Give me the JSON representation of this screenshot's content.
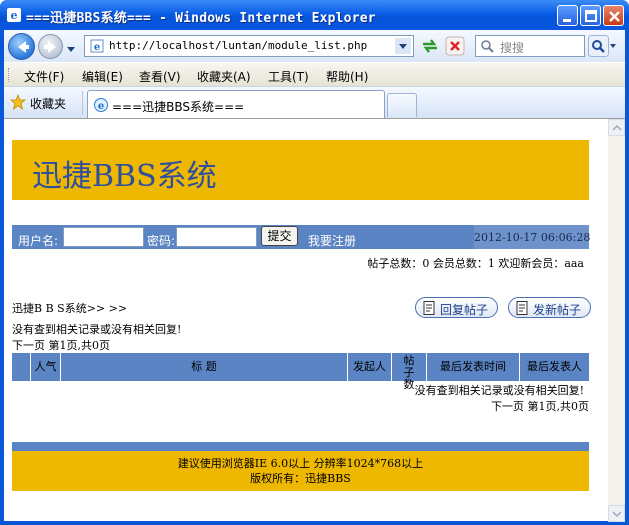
{
  "window": {
    "title": "===迅捷BBS系统=== - Windows Internet Explorer",
    "accent": "#0a56d8"
  },
  "addressbar": {
    "url": "http://localhost/luntan/module_list.php",
    "search_placeholder": "搜搜"
  },
  "menu": {
    "items": [
      "文件(F)",
      "编辑(E)",
      "查看(V)",
      "收藏夹(A)",
      "工具(T)",
      "帮助(H)"
    ]
  },
  "favorites": {
    "label": "收藏夹"
  },
  "tabs": [
    {
      "label": "===迅捷BBS系统==="
    }
  ],
  "page": {
    "banner_title": "迅捷BBS系统",
    "banner_color": "#eeb800",
    "bar_color": "#5b84c4",
    "login": {
      "username_label": "用户名:",
      "password_label": "密码:",
      "submit_label": "提交",
      "register_label": "我要注册",
      "datetime": "2012-10-17 06:06:28"
    },
    "stats": "帖子总数：0  会员总数：1  欢迎新会员：aaa",
    "breadcrumb": "迅捷B B S系统>> >>",
    "reply_button": "回复帖子",
    "new_post_button": "发新帖子",
    "no_records": "没有查到相关记录或没有相关回复!",
    "pager": "下一页  第1页,共0页",
    "table_headers": [
      "",
      "人气",
      "标      题",
      "发起人",
      "帖子数",
      "最后发表时间",
      "最后发表人"
    ],
    "empty_row": "没有查到相关记录或没有相关回复!",
    "footer_line1": "建议使用浏览器IE 6.0以上  分辨率1024*768以上",
    "footer_line2": "版权所有：迅捷BBS"
  }
}
